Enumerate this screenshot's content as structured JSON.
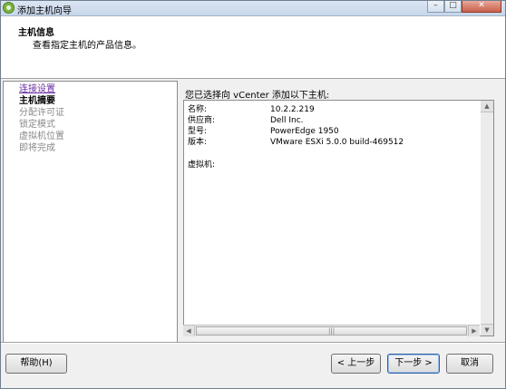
{
  "window": {
    "title": "添加主机向导"
  },
  "header": {
    "title": "主机信息",
    "subtitle": "查看指定主机的产品信息。"
  },
  "steps": [
    {
      "label": "连接设置",
      "state": "link"
    },
    {
      "label": "主机摘要",
      "state": "current"
    },
    {
      "label": "分配许可证",
      "state": "disabled"
    },
    {
      "label": "锁定模式",
      "state": "disabled"
    },
    {
      "label": "虚拟机位置",
      "state": "disabled"
    },
    {
      "label": "即将完成",
      "state": "disabled"
    }
  ],
  "main": {
    "heading": "您已选择向 vCenter 添加以下主机:",
    "fields": [
      {
        "key": "名称:",
        "value": "10.2.2.219"
      },
      {
        "key": "供应商:",
        "value": "Dell Inc."
      },
      {
        "key": "型号:",
        "value": "PowerEdge 1950"
      },
      {
        "key": "版本:",
        "value": "VMware ESXi 5.0.0 build-469512"
      }
    ],
    "vm_label": "虚拟机:"
  },
  "buttons": {
    "help": "帮助(H)",
    "back": "< 上一步",
    "next": "下一步 >",
    "cancel": "取消"
  },
  "icons": {
    "app": "vsphere-wizard-icon",
    "minimize": "minimize-icon",
    "maximize": "maximize-icon",
    "close": "close-icon"
  }
}
